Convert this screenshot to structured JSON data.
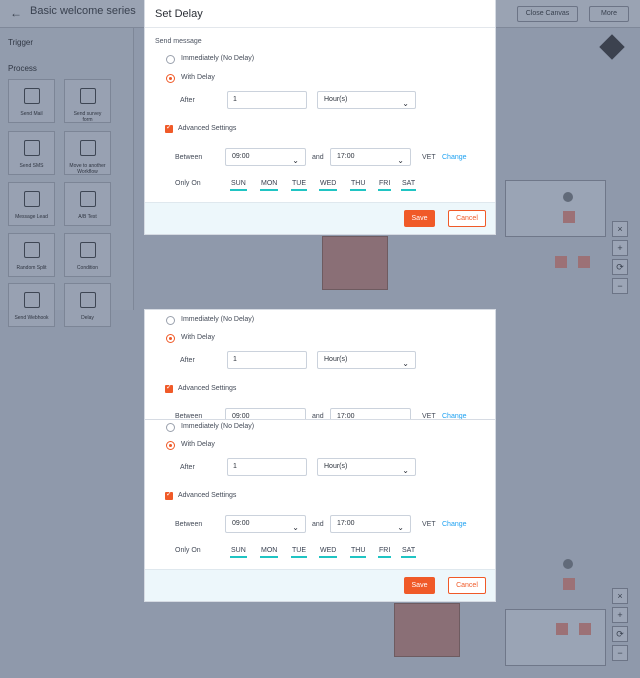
{
  "app": {
    "title": "Basic welcome series",
    "close_canvas": "Close Canvas",
    "more": "More",
    "sections": [
      "Trigger",
      "Process"
    ]
  },
  "tiles": [
    {
      "label": "Send Mail"
    },
    {
      "label": "Send survey form"
    },
    {
      "label": "Send SMS"
    },
    {
      "label": "Move to another Workflow"
    },
    {
      "label": "Message Lead"
    },
    {
      "label": "A/B Test"
    },
    {
      "label": "Random Split"
    },
    {
      "label": "Condition"
    },
    {
      "label": "Send Webhook"
    },
    {
      "label": "Delay"
    }
  ],
  "dialog": {
    "title": "Set Delay",
    "send_message": "Send message",
    "radio_immediate": "Immediately (No Delay)",
    "radio_with_delay": "With Delay",
    "after_label": "After",
    "after_value": "1",
    "unit_value": "Hour(s)",
    "advanced": "Advanced Settings",
    "between_label": "Between",
    "start_time": "09:00",
    "and_label": "and",
    "end_time": "17:00",
    "timezone": "VET",
    "change": "Change",
    "only_on": "Only On",
    "days": [
      "SUN",
      "MON",
      "TUE",
      "WED",
      "THU",
      "FRI",
      "SAT"
    ],
    "save": "Save",
    "cancel": "Cancel"
  }
}
